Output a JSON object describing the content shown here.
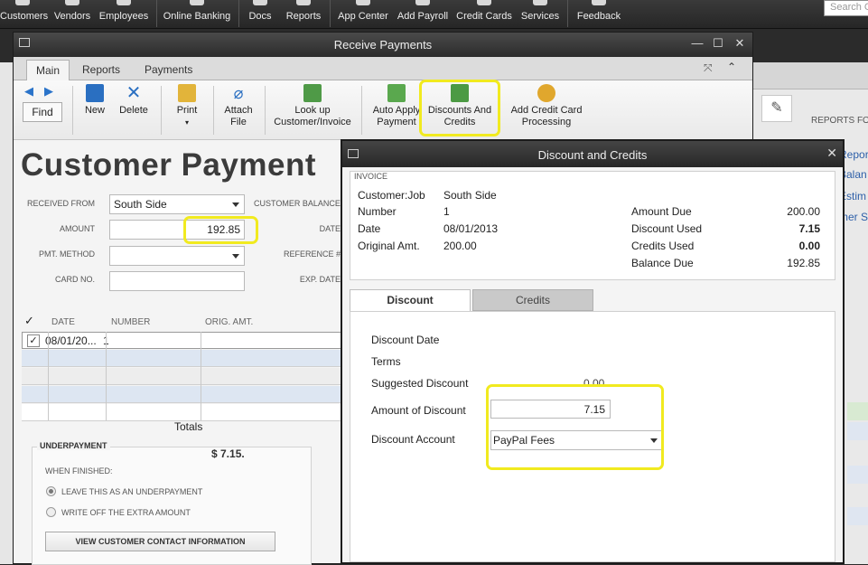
{
  "app_toolbar": {
    "items": [
      {
        "label": "Customers",
        "icon": "customers-icon"
      },
      {
        "label": "Vendors",
        "icon": "vendors-icon"
      },
      {
        "label": "Employees",
        "icon": "employees-icon"
      },
      {
        "label": "Online Banking",
        "icon": "online-banking-icon"
      },
      {
        "label": "Docs",
        "icon": "docs-icon"
      },
      {
        "label": "Reports",
        "icon": "reports-icon"
      },
      {
        "label": "App Center",
        "icon": "app-center-icon"
      },
      {
        "label": "Add Payroll",
        "icon": "add-payroll-icon"
      },
      {
        "label": "Credit Cards",
        "icon": "credit-cards-icon"
      },
      {
        "label": "Services",
        "icon": "services-icon"
      },
      {
        "label": "Feedback",
        "icon": "feedback-icon"
      }
    ],
    "search_placeholder": "Search C"
  },
  "background_right": {
    "reports_label": "REPORTS FOR",
    "links": [
      "Repor",
      "Balan",
      "Estim",
      "mer S"
    ]
  },
  "receive_payments": {
    "title": "Receive Payments",
    "tabs": [
      "Main",
      "Reports",
      "Payments"
    ],
    "active_tab": "Main",
    "ribbon": {
      "find": "Find",
      "new": "New",
      "delete": "Delete",
      "print": "Print",
      "attach_file": [
        "Attach",
        "File"
      ],
      "look_up": [
        "Look up",
        "Customer/Invoice"
      ],
      "auto_apply": [
        "Auto Apply",
        "Payment"
      ],
      "discounts_credits": [
        "Discounts And",
        "Credits"
      ],
      "add_credit_card": [
        "Add Credit Card",
        "Processing"
      ]
    },
    "heading": "Customer Payment",
    "form": {
      "received_from_label": "RECEIVED FROM",
      "received_from_value": "South Side",
      "customer_balance_label": "CUSTOMER BALANCE",
      "amount_label": "AMOUNT",
      "amount_value": "192.85",
      "date_label": "DATE",
      "pmt_method_label": "PMT. METHOD",
      "reference_label": "REFERENCE #",
      "card_no_label": "CARD NO.",
      "exp_date_label": "EXP. DATE"
    },
    "grid": {
      "columns": [
        "DATE",
        "NUMBER",
        "ORIG. AMT."
      ],
      "rows": [
        {
          "checked": true,
          "date": "08/01/20...",
          "number": "1"
        }
      ],
      "totals_label": "Totals"
    },
    "underpayment": {
      "title": "UNDERPAYMENT",
      "amount": "$ 7.15.",
      "when_finished": "WHEN FINISHED:",
      "option_leave": "LEAVE THIS AS AN UNDERPAYMENT",
      "option_write_off": "WRITE OFF THE EXTRA AMOUNT",
      "view_contact_button": "VIEW CUSTOMER CONTACT INFORMATION"
    }
  },
  "discount_credits": {
    "title": "Discount and Credits",
    "invoice": {
      "section": "INVOICE",
      "customer_job_label": "Customer:Job",
      "customer_job_value": "South Side",
      "number_label": "Number",
      "number_value": "1",
      "date_label": "Date",
      "date_value": "08/01/2013",
      "orig_amt_label": "Original Amt.",
      "orig_amt_value": "200.00",
      "amount_due_label": "Amount Due",
      "amount_due_value": "200.00",
      "discount_used_label": "Discount Used",
      "discount_used_value": "7.15",
      "credits_used_label": "Credits Used",
      "credits_used_value": "0.00",
      "balance_due_label": "Balance Due",
      "balance_due_value": "192.85"
    },
    "tabs": [
      "Discount",
      "Credits"
    ],
    "active_tab": "Discount",
    "discount": {
      "date_label": "Discount Date",
      "terms_label": "Terms",
      "suggested_label": "Suggested Discount",
      "suggested_value": "0.00",
      "amount_label": "Amount of Discount",
      "amount_value": "7.15",
      "account_label": "Discount Account",
      "account_value": "PayPal Fees"
    }
  },
  "colors": {
    "highlight": "#f1ea1f",
    "toolbar_dark": "#2b2b2b",
    "link_blue": "#2d5fa8"
  }
}
